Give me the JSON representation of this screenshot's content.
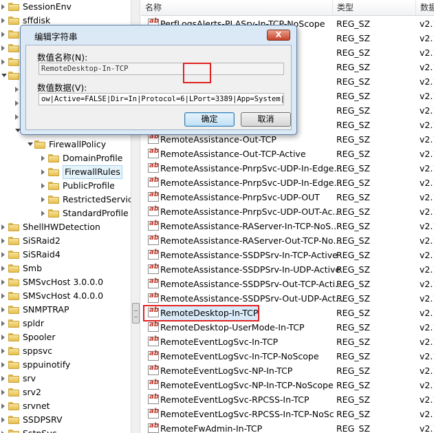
{
  "tree": {
    "items": [
      {
        "label": "SessionEnv",
        "level": 0,
        "expanded": false
      },
      {
        "label": "sffdisk",
        "level": 0,
        "expanded": false
      },
      {
        "label": "s",
        "level": 0,
        "expanded": false
      },
      {
        "label": "s",
        "level": 0,
        "expanded": false
      },
      {
        "label": "s",
        "level": 0,
        "expanded": false
      },
      {
        "label": "S",
        "level": 0,
        "expanded": true
      },
      {
        "label": "",
        "level": 1,
        "expanded": false
      },
      {
        "label": "",
        "level": 1,
        "expanded": false
      },
      {
        "label": "",
        "level": 1,
        "expanded": false
      },
      {
        "label": "",
        "level": 1,
        "expanded": true
      },
      {
        "label": "FirewallPolicy",
        "level": 2,
        "expanded": true
      },
      {
        "label": "DomainProfile",
        "level": 3,
        "expanded": false
      },
      {
        "label": "FirewallRules",
        "level": 3,
        "expanded": false,
        "selected": true
      },
      {
        "label": "PublicProfile",
        "level": 3,
        "expanded": false
      },
      {
        "label": "RestrictedService",
        "level": 3,
        "expanded": false
      },
      {
        "label": "StandardProfile",
        "level": 3,
        "expanded": false
      },
      {
        "label": "ShellHWDetection",
        "level": 0,
        "expanded": false
      },
      {
        "label": "SiSRaid2",
        "level": 0,
        "expanded": false
      },
      {
        "label": "SiSRaid4",
        "level": 0,
        "expanded": false
      },
      {
        "label": "Smb",
        "level": 0,
        "expanded": false
      },
      {
        "label": "SMSvcHost 3.0.0.0",
        "level": 0,
        "expanded": false
      },
      {
        "label": "SMSvcHost 4.0.0.0",
        "level": 0,
        "expanded": false
      },
      {
        "label": "SNMPTRAP",
        "level": 0,
        "expanded": false
      },
      {
        "label": "spldr",
        "level": 0,
        "expanded": false
      },
      {
        "label": "Spooler",
        "level": 0,
        "expanded": false
      },
      {
        "label": "sppsvc",
        "level": 0,
        "expanded": false
      },
      {
        "label": "sppuinotify",
        "level": 0,
        "expanded": false
      },
      {
        "label": "srv",
        "level": 0,
        "expanded": false
      },
      {
        "label": "srv2",
        "level": 0,
        "expanded": false
      },
      {
        "label": "srvnet",
        "level": 0,
        "expanded": false
      },
      {
        "label": "SSDPSRV",
        "level": 0,
        "expanded": false
      },
      {
        "label": "SstpSvc",
        "level": 0,
        "expanded": false
      }
    ]
  },
  "list": {
    "columns": [
      "名称",
      "类型",
      "数据"
    ],
    "rows": [
      {
        "name": "PerfLogsAlerts-PLASrv-In-TCP-NoScope",
        "type": "REG_SZ",
        "data": "v2.1"
      },
      {
        "name": "",
        "type": "REG_SZ",
        "data": "v2.1"
      },
      {
        "name": "",
        "type": "REG_SZ",
        "data": "v2.1"
      },
      {
        "name": "",
        "type": "REG_SZ",
        "data": "v2.1"
      },
      {
        "name": "",
        "type": "REG_SZ",
        "data": "v2.1"
      },
      {
        "name": "NoSco",
        "type": "REG_SZ",
        "data": "v2.1"
      },
      {
        "name": "ope",
        "type": "REG_SZ",
        "data": "v2.1"
      },
      {
        "name": "pe-Ac",
        "type": "REG_SZ",
        "data": "v2.1"
      },
      {
        "name": "RemoteAssistance-Out-TCP",
        "type": "REG_SZ",
        "data": "v2.1"
      },
      {
        "name": "RemoteAssistance-Out-TCP-Active",
        "type": "REG_SZ",
        "data": "v2.1"
      },
      {
        "name": "RemoteAssistance-PnrpSvc-UDP-In-Edge...",
        "type": "REG_SZ",
        "data": "v2.1"
      },
      {
        "name": "RemoteAssistance-PnrpSvc-UDP-In-Edge...",
        "type": "REG_SZ",
        "data": "v2.1"
      },
      {
        "name": "RemoteAssistance-PnrpSvc-UDP-OUT",
        "type": "REG_SZ",
        "data": "v2.1"
      },
      {
        "name": "RemoteAssistance-PnrpSvc-UDP-OUT-Ac...",
        "type": "REG_SZ",
        "data": "v2.1"
      },
      {
        "name": "RemoteAssistance-RAServer-In-TCP-NoS...",
        "type": "REG_SZ",
        "data": "v2.1"
      },
      {
        "name": "RemoteAssistance-RAServer-Out-TCP-No...",
        "type": "REG_SZ",
        "data": "v2.1"
      },
      {
        "name": "RemoteAssistance-SSDPSrv-In-TCP-Active",
        "type": "REG_SZ",
        "data": "v2.1"
      },
      {
        "name": "RemoteAssistance-SSDPSrv-In-UDP-Active",
        "type": "REG_SZ",
        "data": "v2.1"
      },
      {
        "name": "RemoteAssistance-SSDPSrv-Out-TCP-Acti...",
        "type": "REG_SZ",
        "data": "v2.1"
      },
      {
        "name": "RemoteAssistance-SSDPSrv-Out-UDP-Act...",
        "type": "REG_SZ",
        "data": "v2.1"
      },
      {
        "name": "RemoteDesktop-In-TCP",
        "type": "REG_SZ",
        "data": "v2.1",
        "highlighted": true
      },
      {
        "name": "RemoteDesktop-UserMode-In-TCP",
        "type": "REG_SZ",
        "data": "v2.1"
      },
      {
        "name": "RemoteEventLogSvc-In-TCP",
        "type": "REG_SZ",
        "data": "v2.1"
      },
      {
        "name": "RemoteEventLogSvc-In-TCP-NoScope",
        "type": "REG_SZ",
        "data": "v2.1"
      },
      {
        "name": "RemoteEventLogSvc-NP-In-TCP",
        "type": "REG_SZ",
        "data": "v2.1"
      },
      {
        "name": "RemoteEventLogSvc-NP-In-TCP-NoScope",
        "type": "REG_SZ",
        "data": "v2.1"
      },
      {
        "name": "RemoteEventLogSvc-RPCSS-In-TCP",
        "type": "REG_SZ",
        "data": "v2.1"
      },
      {
        "name": "RemoteEventLogSvc-RPCSS-In-TCP-NoSc",
        "type": "REG_SZ",
        "data": "v2.1"
      },
      {
        "name": "RemoteFwAdmin-In-TCP",
        "type": "REG_SZ",
        "data": "v2.1"
      }
    ]
  },
  "dialog": {
    "title": "编辑字符串",
    "close_label": "X",
    "name_label": "数值名称(N):",
    "name_value": "RemoteDesktop-In-TCP",
    "data_label": "数值数据(V):",
    "data_value": "ow|Active=FALSE|Dir=In|Protocol=6|LPort=3389|App=System|Nam",
    "ok_label": "确定",
    "cancel_label": "取消"
  },
  "colors": {
    "highlight_border": "#e02020",
    "dialog_bg": "#dbe8f5"
  }
}
